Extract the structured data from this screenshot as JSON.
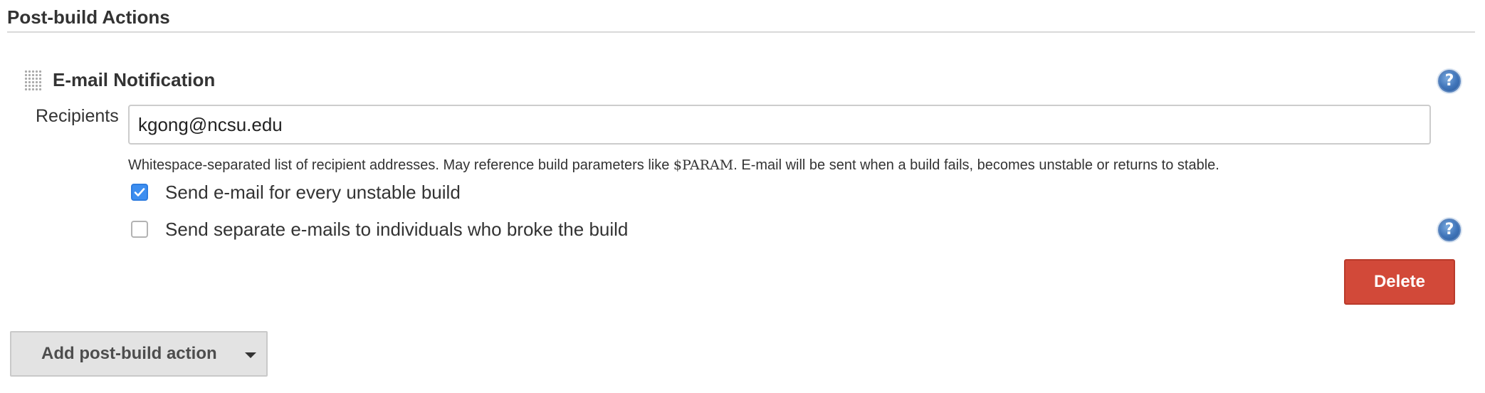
{
  "section": {
    "title": "Post-build Actions"
  },
  "email_block": {
    "title": "E-mail Notification",
    "recipients_label": "Recipients",
    "recipients_value": "kgong@ncsu.edu",
    "help_text_before": "Whitespace-separated list of recipient addresses. May reference build parameters like ",
    "help_text_code": "$PARAM",
    "help_text_after": ". E-mail will be sent when a build fails, becomes unstable or returns to stable.",
    "options": [
      {
        "label": "Send e-mail for every unstable build",
        "checked": true
      },
      {
        "label": "Send separate e-mails to individuals who broke the build",
        "checked": false
      }
    ],
    "delete_label": "Delete",
    "help_icon_glyph": "?"
  },
  "footer": {
    "add_action_label": "Add post-build action"
  },
  "colors": {
    "delete": "#d24939",
    "checkbox_checked": "#3d8ef0",
    "help_icon": "#3f74b9"
  }
}
